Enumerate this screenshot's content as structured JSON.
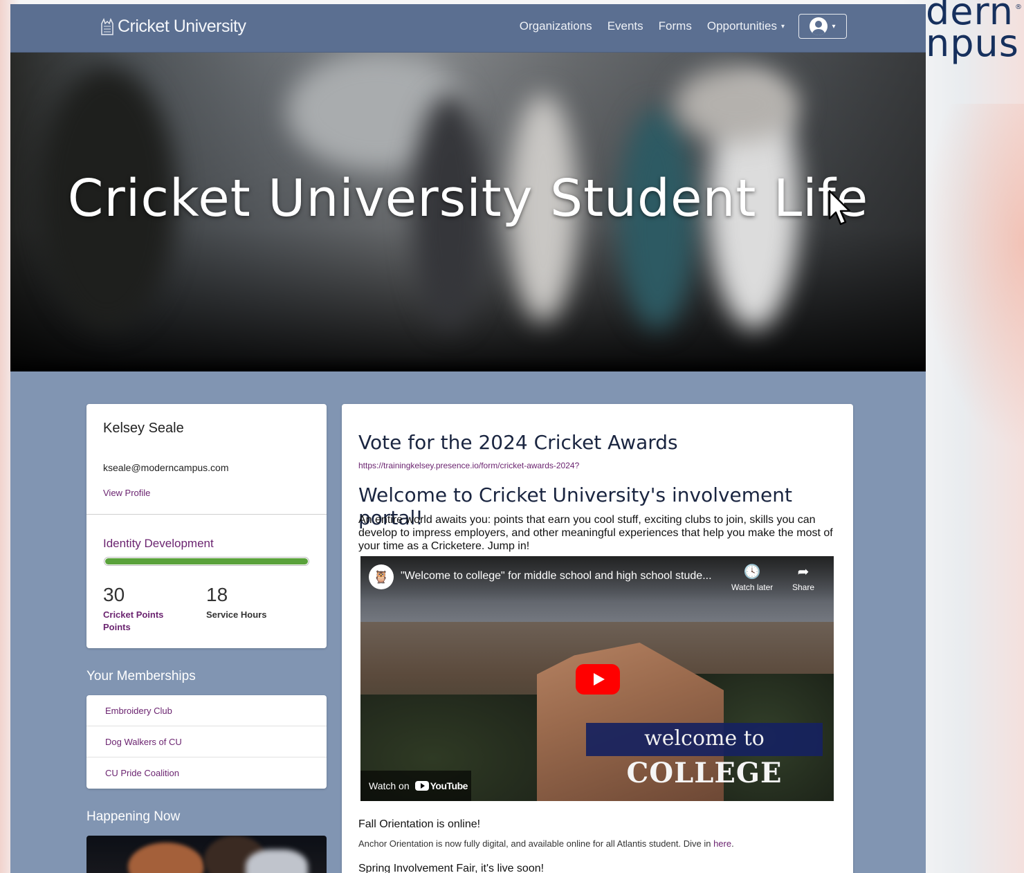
{
  "nav": {
    "brand": "Cricket University",
    "links": [
      "Organizations",
      "Events",
      "Forms",
      "Opportunities"
    ],
    "opportunities_caret": "▾",
    "user_caret": "▾"
  },
  "hero": {
    "title": "Cricket University Student Life"
  },
  "corner_brand": {
    "line1": "dern",
    "line2": "npus",
    "reg": "®"
  },
  "profile": {
    "name": "Kelsey Seale",
    "email": "kseale@moderncampus.com",
    "view_profile": "View Profile",
    "pathway": "Identity Development",
    "progress": 1.0,
    "stat1_value": "30",
    "stat1_label": "Cricket Points Points",
    "stat2_value": "18",
    "stat2_label": "Service Hours"
  },
  "memberships": {
    "title": "Your Memberships",
    "items": [
      "Embroidery Club",
      "Dog Walkers of CU",
      "CU Pride Coalition"
    ]
  },
  "happening": {
    "title": "Happening Now"
  },
  "main": {
    "vote_heading": "Vote for the 2024 Cricket Awards",
    "vote_link": "https://trainingkelsey.presence.io/form/cricket-awards-2024?",
    "welcome_heading": "Welcome to Cricket University's involvement portal!",
    "intro": "An entire world awaits you: points that earn you cool stuff, exciting clubs to join, skills you can develop to impress employers, and other meaningful experiences that help you make the most of your time as a Cricketere. Jump in!",
    "video": {
      "title": "\"Welcome to college\" for middle school and high school stude...",
      "watch_later": "Watch later",
      "share": "Share",
      "banner_line1": "welcome to",
      "banner_line2": "COLLEGE",
      "watch_on": "Watch on",
      "youtube": "YouTube"
    },
    "post1_title": "Fall Orientation is online!",
    "post1_body": "Anchor Orientation is now fully digital, and available online for all Atlantis student. Dive in",
    "post1_link": "here",
    "post1_end": ".",
    "post2_title": "Spring Involvement Fair, it's live soon!"
  },
  "colors": {
    "nav_bg": "#5b6f91",
    "page_bg": "#8195b2",
    "accent_purple": "#6b2470",
    "progress_green": "#5aa23b"
  }
}
